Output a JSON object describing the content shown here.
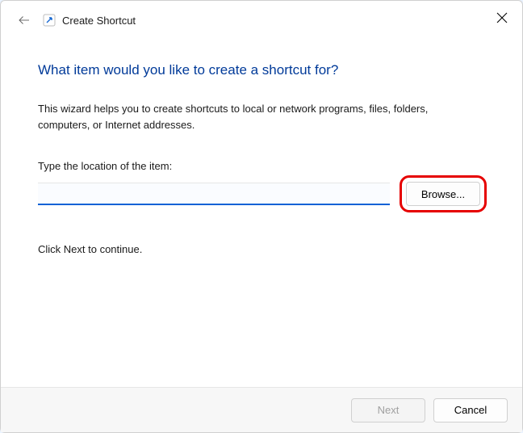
{
  "titlebar": {
    "wizard_name": "Create Shortcut"
  },
  "heading": "What item would you like to create a shortcut for?",
  "description": "This wizard helps you to create shortcuts to local or network programs, files, folders, computers, or Internet addresses.",
  "field": {
    "label": "Type the location of the item:",
    "value": "",
    "browse_label": "Browse..."
  },
  "hint": "Click Next to continue.",
  "footer": {
    "next_label": "Next",
    "cancel_label": "Cancel",
    "next_enabled": false
  }
}
